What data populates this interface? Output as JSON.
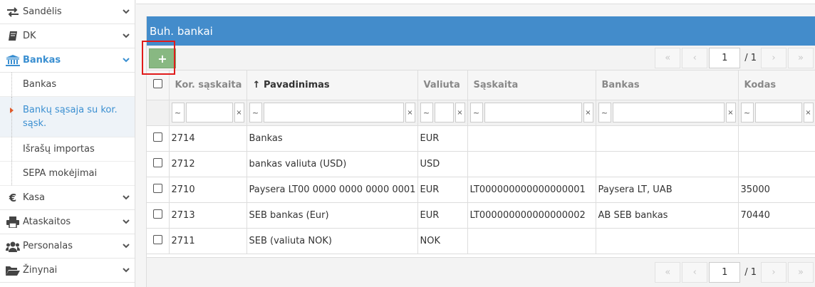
{
  "sidebar": {
    "items": [
      {
        "label": "Sandėlis",
        "icon": "transfer-icon"
      },
      {
        "label": "DK",
        "icon": "book-icon"
      },
      {
        "label": "Bankas",
        "icon": "bank-icon"
      },
      {
        "label": "Kasa",
        "icon": "euro-icon"
      },
      {
        "label": "Ataskaitos",
        "icon": "printer-icon"
      },
      {
        "label": "Personalas",
        "icon": "users-icon"
      },
      {
        "label": "Žinynai",
        "icon": "folder-icon"
      }
    ],
    "bank_sub": [
      {
        "label": "Bankas"
      },
      {
        "label": "Bankų sąsaja su kor. sąsk."
      },
      {
        "label": "Išrašų importas"
      },
      {
        "label": "SEPA mokėjimai"
      }
    ],
    "accent": "#3a8fd1"
  },
  "panel": {
    "title": "Buh. bankai",
    "add_label": "+",
    "header_color": "#438ccb"
  },
  "pager": {
    "first": "«",
    "prev": "‹",
    "next": "›",
    "last": "»",
    "page": "1",
    "total": "/ 1"
  },
  "table": {
    "columns": [
      "Kor. sąskaita",
      "Pavadinimas",
      "Valiuta",
      "Sąskaita",
      "Bankas",
      "Kodas"
    ],
    "sort_arrow": "↑",
    "filter_tilde": "~",
    "filter_clear": "×",
    "rows": [
      [
        "2714",
        "Bankas",
        "EUR",
        "",
        "",
        ""
      ],
      [
        "2712",
        "bankas valiuta (USD)",
        "USD",
        "",
        "",
        ""
      ],
      [
        "2710",
        "Paysera LT00 0000 0000 0000 0001",
        "EUR",
        "LT000000000000000001",
        "Paysera LT, UAB",
        "35000"
      ],
      [
        "2713",
        "SEB bankas (Eur)",
        "EUR",
        "LT000000000000000002",
        "AB SEB bankas",
        "70440"
      ],
      [
        "2711",
        "SEB (valiuta NOK)",
        "NOK",
        "",
        "",
        ""
      ]
    ]
  }
}
